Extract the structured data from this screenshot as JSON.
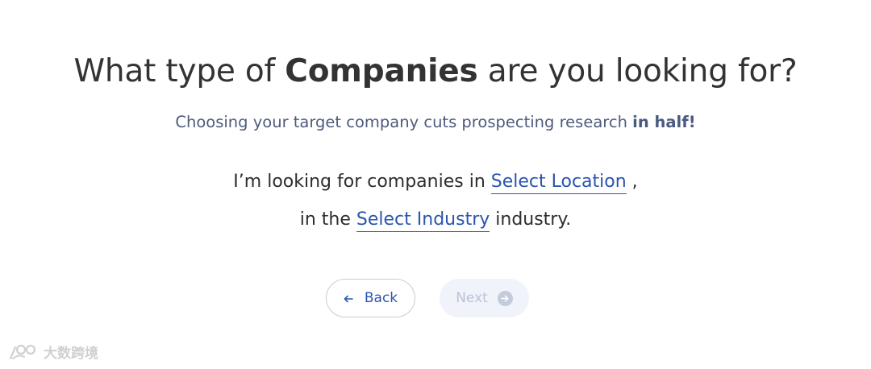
{
  "headline": {
    "part1": "What type of ",
    "bold": "Companies",
    "part2": " are you looking for?"
  },
  "subhead": {
    "text": "Choosing your target company cuts prospecting research ",
    "bold": "in half!"
  },
  "sentence": {
    "line1_prefix": "I’m looking for companies in ",
    "location_link": "Select Location",
    "line1_suffix": " ,",
    "line2_prefix": "in the ",
    "industry_link": "Select Industry",
    "line2_suffix": " industry."
  },
  "buttons": {
    "back_label": "Back",
    "back_icon": "arrow-left-icon",
    "next_label": "Next",
    "next_icon": "arrow-right-circle-icon"
  },
  "watermark": {
    "text": "大数跨境"
  },
  "colors": {
    "accent": "#2b55b0",
    "subhead": "#4f5b7e",
    "next_disabled_bg": "#f0f3fa"
  }
}
